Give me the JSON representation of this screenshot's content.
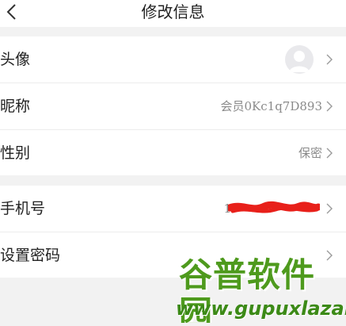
{
  "header": {
    "title": "修改信息",
    "back_icon": "chevron-left-icon"
  },
  "profile": {
    "avatar_label": "头像",
    "avatar_icon": "default-avatar-icon",
    "nickname_label": "昵称",
    "nickname_value": "会员0Kc1q7D893",
    "gender_label": "性别",
    "gender_value": "保密"
  },
  "security": {
    "phone_label": "手机号",
    "phone_value": "1",
    "password_label": "设置密码"
  },
  "colors": {
    "redaction": "#e8201a",
    "watermark": "#4e9a1d",
    "background": "#f2f2f2"
  },
  "watermark": {
    "logo_text": "谷普软件园",
    "url": "www.gupuxlazal.com"
  }
}
